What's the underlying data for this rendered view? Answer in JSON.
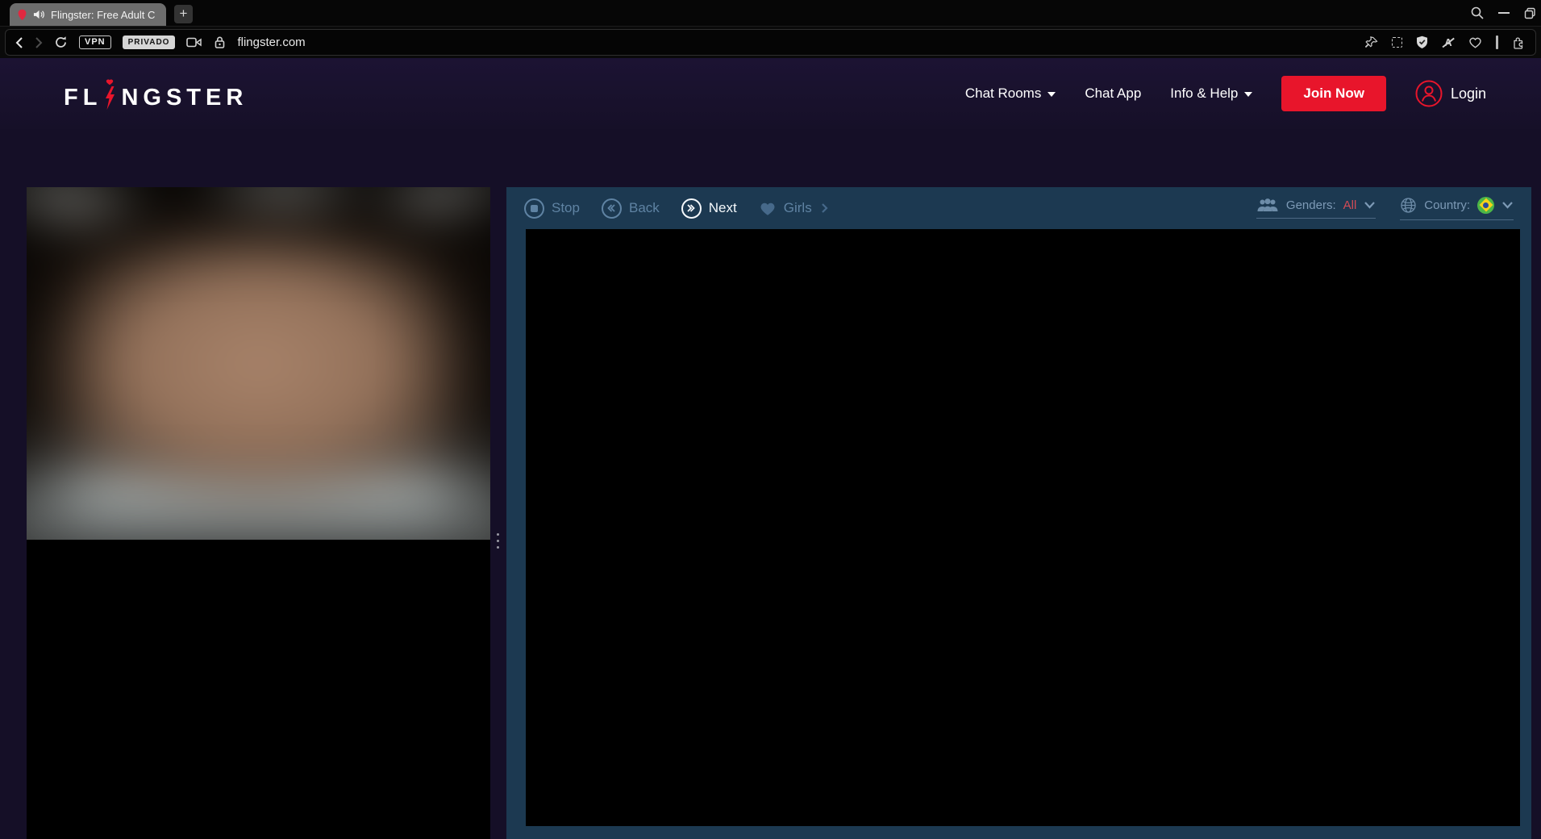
{
  "browser": {
    "tab_title": "Flingster: Free Adult C",
    "new_tab_button": "+",
    "vpn_badge": "VPN",
    "privado_badge": "PRIVADO",
    "url": "flingster.com"
  },
  "header": {
    "brand_prefix": "FL",
    "brand_suffix": "NGSTER",
    "nav": [
      {
        "label": "Chat Rooms",
        "has_dropdown": true
      },
      {
        "label": "Chat App",
        "has_dropdown": false
      },
      {
        "label": "Info & Help",
        "has_dropdown": true
      }
    ],
    "join_button": "Join Now",
    "login_label": "Login"
  },
  "controls": {
    "stop": "Stop",
    "back": "Back",
    "next": "Next",
    "girls": "Girls",
    "genders_label": "Genders:",
    "genders_value": "All",
    "country_label": "Country:",
    "country_flag_icon": "brazil-flag-icon"
  },
  "colors": {
    "accent_red": "#e8152b",
    "panel_navy": "#1c3951",
    "muted_blue": "#5f83a3",
    "page_purple": "#150f27",
    "genders_all_red": "#d34b56",
    "flag_green": "#4cb648",
    "flag_yellow": "#f5d21a",
    "flag_blue": "#2a4b9b"
  }
}
